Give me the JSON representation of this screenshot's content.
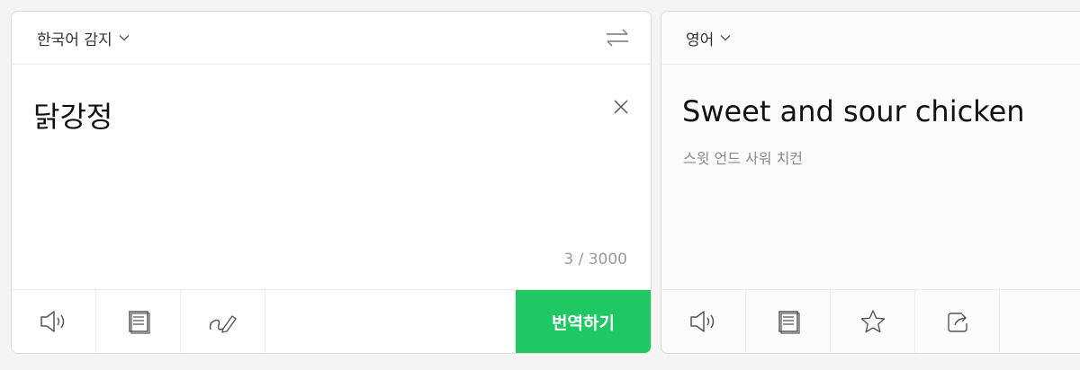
{
  "source": {
    "language_label": "한국어 감지",
    "text": "닭강정",
    "char_count": "3 / 3000",
    "translate_button": "번역하기"
  },
  "target": {
    "language_label": "영어",
    "text": "Sweet and sour chicken",
    "pronunciation": "스윗 언드 사워 치컨"
  },
  "colors": {
    "accent": "#1ec964",
    "icon": "#555555",
    "counter": "#9a9a9a"
  },
  "icons": {
    "source_footer": [
      "speaker-icon",
      "document-icon",
      "handwriting-icon"
    ],
    "target_footer": [
      "speaker-icon",
      "document-icon",
      "star-icon",
      "share-icon"
    ]
  }
}
